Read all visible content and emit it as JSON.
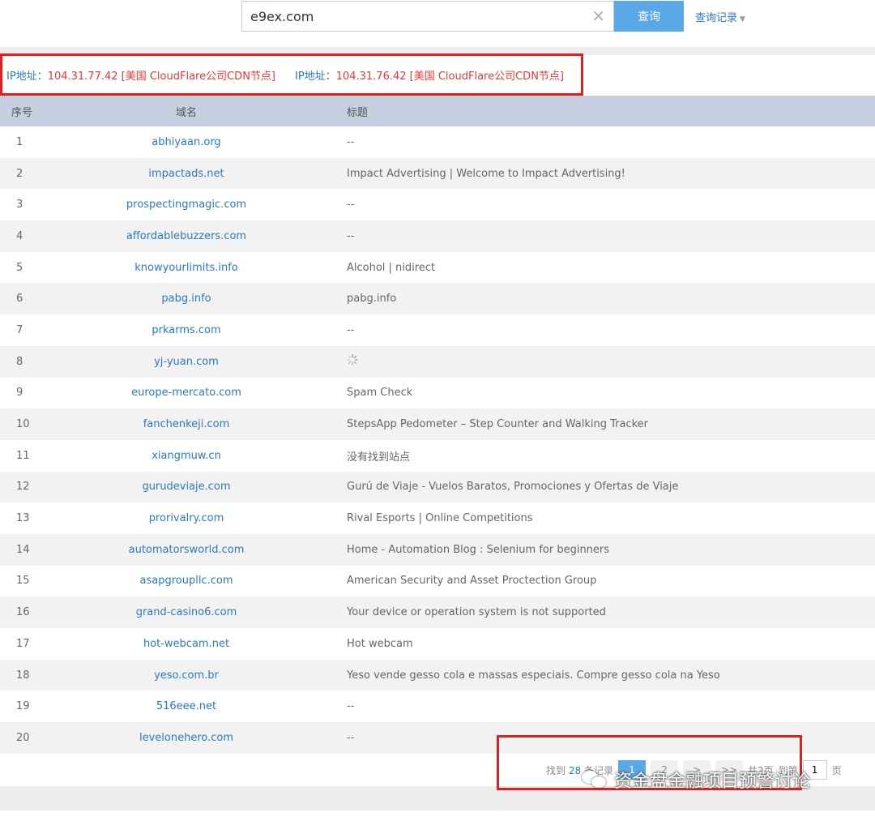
{
  "search": {
    "value": "e9ex.com",
    "clear_icon": "×",
    "button_label": "查询",
    "history_label": "查询记录",
    "history_caret": "▼"
  },
  "ip_info": [
    {
      "label": "IP地址：",
      "value": "104.31.77.42 [美国 CloudFlare公司CDN节点]"
    },
    {
      "label": "IP地址：",
      "value": "104.31.76.42 [美国 CloudFlare公司CDN节点]"
    }
  ],
  "table": {
    "headers": {
      "no": "序号",
      "domain": "域名",
      "title": "标题"
    },
    "rows": [
      {
        "no": "1",
        "domain": "abhiyaan.org",
        "title": "--"
      },
      {
        "no": "2",
        "domain": "impactads.net",
        "title": "Impact Advertising | Welcome to Impact Advertising!"
      },
      {
        "no": "3",
        "domain": "prospectingmagic.com",
        "title": "--"
      },
      {
        "no": "4",
        "domain": "affordablebuzzers.com",
        "title": "--"
      },
      {
        "no": "5",
        "domain": "knowyourlimits.info",
        "title": "Alcohol | nidirect"
      },
      {
        "no": "6",
        "domain": "pabg.info",
        "title": "pabg.info"
      },
      {
        "no": "7",
        "domain": "prkarms.com",
        "title": "--"
      },
      {
        "no": "8",
        "domain": "yj-yuan.com",
        "title": ""
      },
      {
        "no": "9",
        "domain": "europe-mercato.com",
        "title": "Spam Check"
      },
      {
        "no": "10",
        "domain": "fanchenkeji.com",
        "title": "StepsApp Pedometer – Step Counter and Walking Tracker"
      },
      {
        "no": "11",
        "domain": "xiangmuw.cn",
        "title": "没有找到站点"
      },
      {
        "no": "12",
        "domain": "gurudeviaje.com",
        "title": "Gurú de Viaje - Vuelos Baratos, Promociones y Ofertas de Viaje"
      },
      {
        "no": "13",
        "domain": "prorivalry.com",
        "title": "Rival Esports | Online Competitions"
      },
      {
        "no": "14",
        "domain": "automatorsworld.com",
        "title": "Home - Automation Blog : Selenium for beginners"
      },
      {
        "no": "15",
        "domain": "asapgroupllc.com",
        "title": "American Security and Asset Proctection Group"
      },
      {
        "no": "16",
        "domain": "grand-casino6.com",
        "title": "Your device or operation system is not supported"
      },
      {
        "no": "17",
        "domain": "hot-webcam.net",
        "title": "Hot webcam"
      },
      {
        "no": "18",
        "domain": "yeso.com.br",
        "title": "Yeso vende gesso cola e massas especiais. Compre gesso cola na Yeso"
      },
      {
        "no": "19",
        "domain": "516eee.net",
        "title": "--"
      },
      {
        "no": "20",
        "domain": "levelonehero.com",
        "title": "--"
      }
    ]
  },
  "pagination": {
    "found_prefix": "找到",
    "found_count": "28",
    "found_suffix": "条记录",
    "pages": [
      "1",
      "2"
    ],
    "next": ">",
    "last": ">>",
    "total_pages": "共2页",
    "goto_label": "到第",
    "goto_value": "1",
    "page_suffix": "页"
  },
  "watermark": {
    "icon": "wechat-icon",
    "text": "资金盘金融项目预警讨论"
  },
  "colors": {
    "accent": "#5aa9e6",
    "link": "#2b79c2",
    "ip_value": "#e53935",
    "highlight_box": "#e02020",
    "header_bg": "#c5cfdf"
  }
}
